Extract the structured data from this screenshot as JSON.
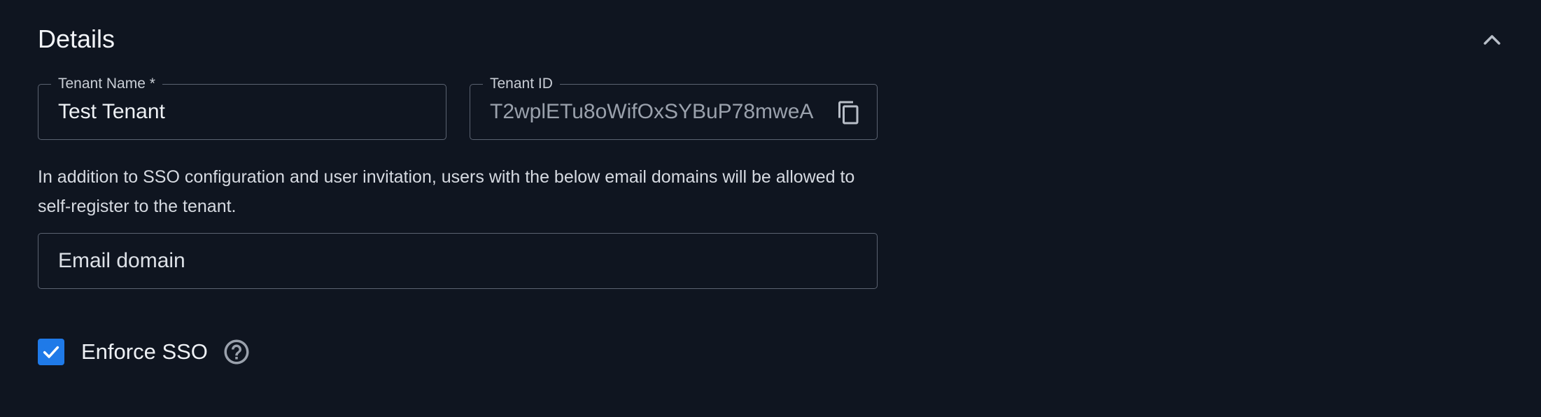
{
  "section": {
    "title": "Details",
    "collapse_icon": "chevron-up-icon"
  },
  "tenant_name": {
    "label": "Tenant Name *",
    "value": "Test Tenant"
  },
  "tenant_id": {
    "label": "Tenant ID",
    "value": "T2wplETu8oWifOxSYBuP78mweA",
    "copy_icon": "copy-icon"
  },
  "email_domains": {
    "help_text": "In addition to SSO configuration and user invitation, users with the below email domains will be allowed to self-register to the tenant.",
    "placeholder": "Email domain",
    "value": ""
  },
  "enforce_sso": {
    "label": "Enforce SSO",
    "checked": true,
    "help_icon": "question-circle-icon"
  },
  "colors": {
    "background": "#0f1520",
    "border": "#5b6371",
    "accent": "#1f7ae8",
    "text": "#eef1f5",
    "muted": "#9aa1ac"
  }
}
